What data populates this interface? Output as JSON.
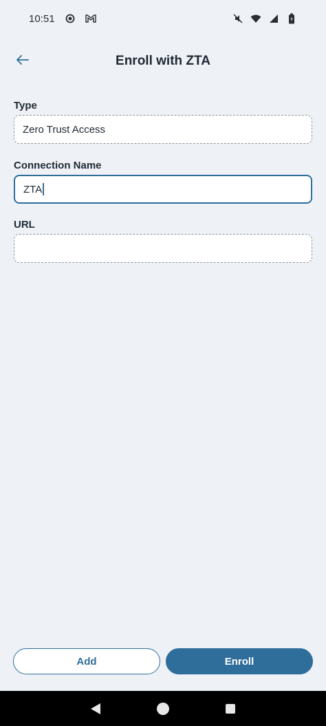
{
  "status_bar": {
    "time": "10:51"
  },
  "header": {
    "title": "Enroll with ZTA"
  },
  "form": {
    "type_label": "Type",
    "type_value": "Zero Trust Access",
    "connection_label": "Connection Name",
    "connection_value": "ZTA",
    "url_label": "URL",
    "url_value": ""
  },
  "buttons": {
    "add_label": "Add",
    "enroll_label": "Enroll"
  },
  "colors": {
    "accent": "#2f6d9b",
    "background": "#eef1f6"
  },
  "icons": {
    "back": "back-arrow-icon",
    "mute": "mute-icon",
    "wifi": "wifi-icon",
    "signal": "signal-icon",
    "battery": "battery-icon"
  }
}
